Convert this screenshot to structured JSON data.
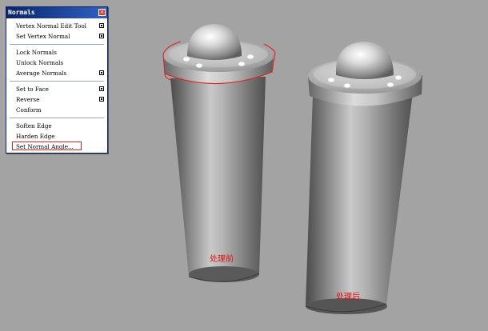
{
  "window": {
    "title": "Normals",
    "close_icon": "×"
  },
  "menu": {
    "groups": [
      [
        {
          "label": "Vertex Normal Edit Tool",
          "options": true
        },
        {
          "label": "Set Vertex Normal",
          "options": true
        }
      ],
      [
        {
          "label": "Lock Normals",
          "options": false
        },
        {
          "label": "Unlock Normals",
          "options": false
        },
        {
          "label": "Average Normals",
          "options": true
        }
      ],
      [
        {
          "label": "Set to Face",
          "options": true
        },
        {
          "label": "Reverse",
          "options": true
        },
        {
          "label": "Conform",
          "options": false
        }
      ],
      [
        {
          "label": "Soften Edge",
          "options": false
        },
        {
          "label": "Harden Edge",
          "options": false
        },
        {
          "label": "Set Normal Angle...",
          "options": false,
          "highlighted": true
        }
      ]
    ]
  },
  "viewport": {
    "background_color": "#a3a3a3",
    "objects": [
      {
        "caption": "处理前",
        "highlight_color": "#e02020"
      },
      {
        "caption": "处理后"
      }
    ]
  }
}
